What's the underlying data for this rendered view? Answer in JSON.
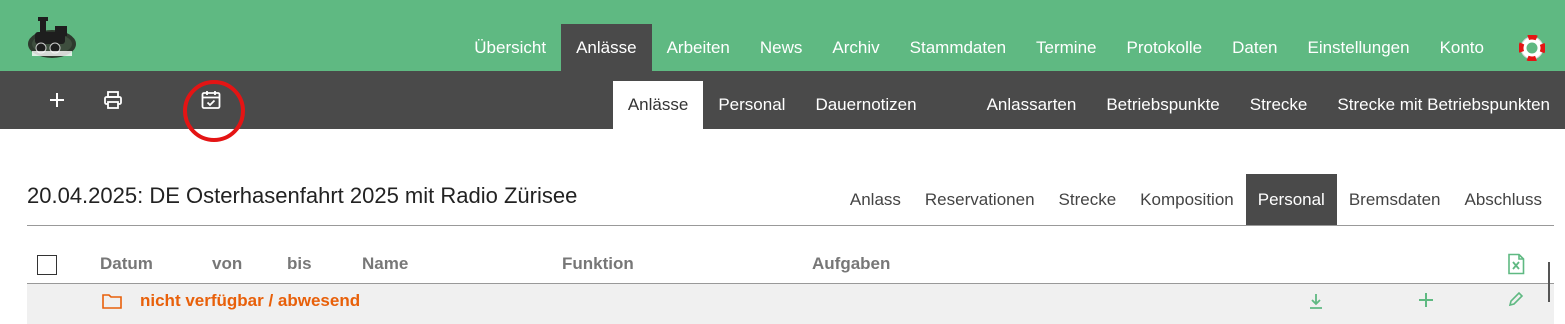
{
  "header": {
    "nav": [
      "Übersicht",
      "Anlässe",
      "Arbeiten",
      "News",
      "Archiv",
      "Stammdaten",
      "Termine",
      "Protokolle",
      "Daten",
      "Einstellungen",
      "Konto"
    ],
    "active_nav": "Anlässe",
    "help_icon": "lifebuoy-icon",
    "brand_color": "#5fb982"
  },
  "toolbar": {
    "tools": [
      "plus-icon",
      "printer-icon",
      "calendar-check-icon"
    ],
    "highlight_color": "#e41414"
  },
  "subnav": {
    "left": [
      "Anlässe",
      "Personal",
      "Dauernotizen"
    ],
    "right": [
      "Anlassarten",
      "Betriebspunkte",
      "Strecke",
      "Strecke mit Betriebspunkten"
    ],
    "active": "Anlässe"
  },
  "event": {
    "title": "20.04.2025: DE Osterhasenfahrt 2025 mit Radio Zürisee",
    "tabs": [
      "Anlass",
      "Reservationen",
      "Strecke",
      "Komposition",
      "Personal",
      "Bremsdaten",
      "Abschluss"
    ],
    "active_tab": "Personal"
  },
  "table": {
    "columns": [
      "Datum",
      "von",
      "bis",
      "Name",
      "Funktion",
      "Aufgaben"
    ],
    "group_label": "nicht verfügbar / abwesend",
    "accent_orange": "#e8600a",
    "icon_green": "#5fb982"
  }
}
